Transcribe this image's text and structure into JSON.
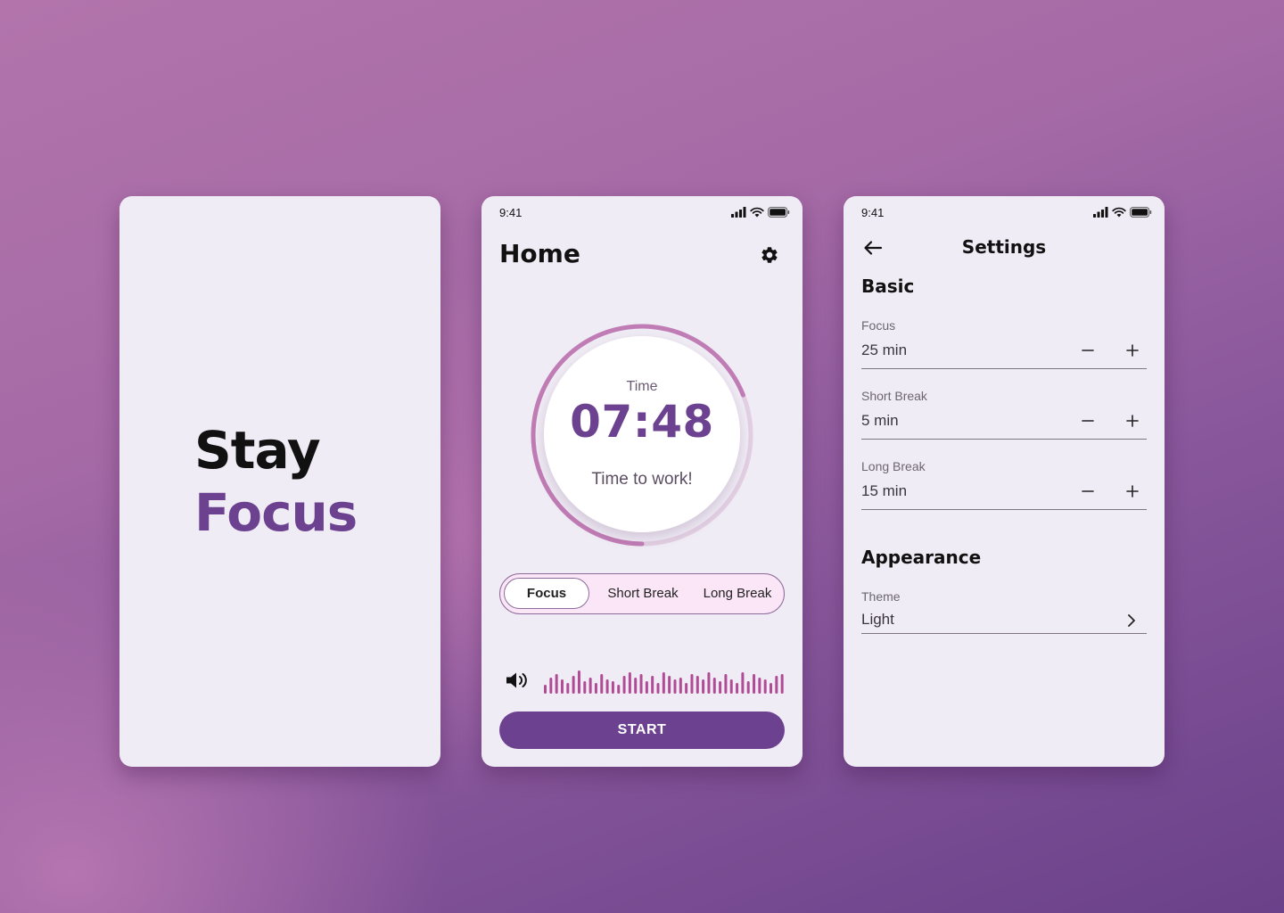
{
  "colors": {
    "accent": "#6c4290",
    "ring": "#c07cb4",
    "ring_track": "#e2cfe2",
    "wave": "#b04c95",
    "card_bg": "#f0ecf5"
  },
  "splash": {
    "line1": "Stay",
    "line2": "Focus"
  },
  "status_bar": {
    "time": "9:41",
    "icons": [
      "signal-icon",
      "wifi-icon",
      "battery-icon"
    ]
  },
  "home": {
    "title": "Home",
    "settings_icon": "gear-icon",
    "timer": {
      "label": "Time",
      "value": "07:48",
      "message": "Time to work!",
      "progress": 0.69
    },
    "modes": [
      {
        "label": "Focus",
        "active": true
      },
      {
        "label": "Short Break",
        "active": false
      },
      {
        "label": "Long Break",
        "active": false
      }
    ],
    "sound_icon": "speaker-icon",
    "start_label": "START"
  },
  "settings": {
    "title": "Settings",
    "back_icon": "arrow-left-icon",
    "basic": {
      "heading": "Basic",
      "rows": [
        {
          "label": "Focus",
          "value": "25 min"
        },
        {
          "label": "Short Break",
          "value": "5 min"
        },
        {
          "label": "Long Break",
          "value": "15 min"
        }
      ]
    },
    "appearance": {
      "heading": "Appearance",
      "theme_label": "Theme",
      "theme_value": "Light"
    }
  }
}
